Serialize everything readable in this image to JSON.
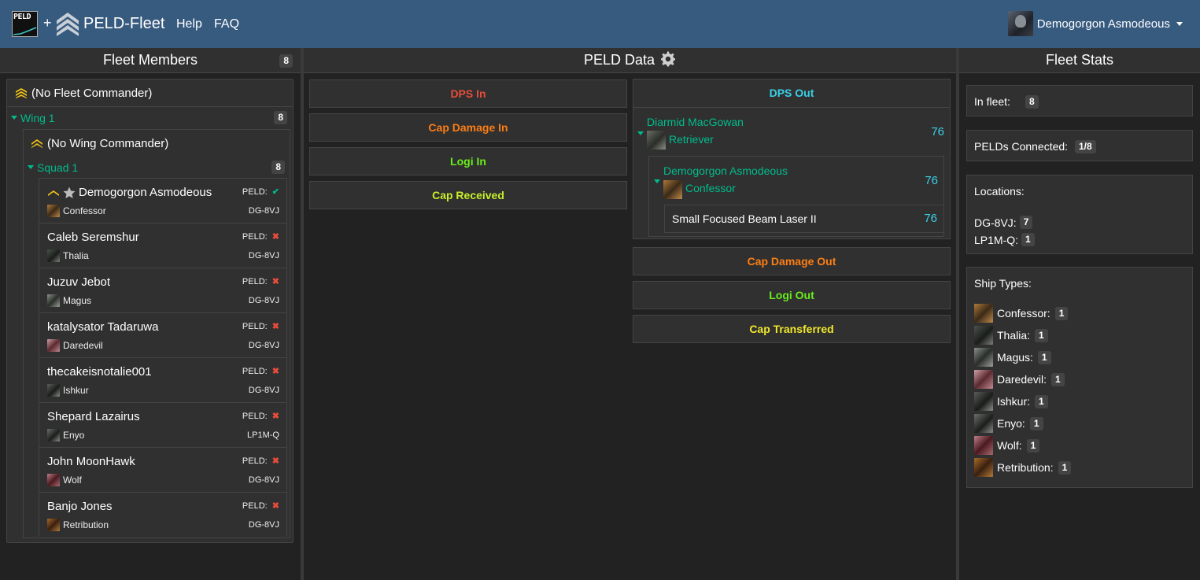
{
  "navbar": {
    "peld_logo_text": "PELD",
    "plus": "+",
    "brand": "PELD-Fleet",
    "help": "Help",
    "faq": "FAQ",
    "user_name": "Demogorgon Asmodeous"
  },
  "colors": {
    "navbar": "#375a7f",
    "background": "#222222",
    "panel": "#303030",
    "green": "#00bc8c",
    "red": "#e74c3c",
    "cyan": "#3bd0e8",
    "orange": "#fd7e14",
    "lime": "#6aed1c",
    "yellow": "#f0e82c",
    "gold": "#f5c518"
  },
  "fleet_members": {
    "title": "Fleet Members",
    "count": "8",
    "fleet_commander": "(No Fleet Commander)",
    "wing": {
      "label": "Wing 1",
      "count": "8",
      "commander": "(No Wing Commander)"
    },
    "squad": {
      "label": "Squad 1",
      "count": "8"
    },
    "peld_label": "PELD:",
    "members": [
      {
        "name": "Demogorgon Asmodeous",
        "ship": "Confessor",
        "location": "DG-8VJ",
        "peld": "✔",
        "icon": "confessor-icon"
      },
      {
        "name": "Caleb Seremshur",
        "ship": "Thalia",
        "location": "DG-8VJ",
        "peld": "✖",
        "icon": "thalia-icon"
      },
      {
        "name": "Juzuv Jebot",
        "ship": "Magus",
        "location": "DG-8VJ",
        "peld": "✖",
        "icon": "magus-icon"
      },
      {
        "name": "katalysator Tadaruwa",
        "ship": "Daredevil",
        "location": "DG-8VJ",
        "peld": "✖",
        "icon": "daredevil-icon"
      },
      {
        "name": "thecakeisnotalie001",
        "ship": "Ishkur",
        "location": "DG-8VJ",
        "peld": "✖",
        "icon": "ishkur-icon"
      },
      {
        "name": "Shepard Lazairus",
        "ship": "Enyo",
        "location": "LP1M-Q",
        "peld": "✖",
        "icon": "enyo-icon"
      },
      {
        "name": "John MoonHawk",
        "ship": "Wolf",
        "location": "DG-8VJ",
        "peld": "✖",
        "icon": "wolf-icon"
      },
      {
        "name": "Banjo Jones",
        "ship": "Retribution",
        "location": "DG-8VJ",
        "peld": "✖",
        "icon": "retribution-icon"
      }
    ]
  },
  "peld_data": {
    "title": "PELD Data",
    "dps_in": "DPS In",
    "cap_damage_in": "Cap Damage In",
    "logi_in": "Logi In",
    "cap_received": "Cap Received",
    "dps_out": {
      "label": "DPS Out",
      "source_name": "Diarmid MacGowan",
      "source_ship": "Retriever",
      "source_value": "76",
      "target_name": "Demogorgon Asmodeous",
      "target_ship": "Confessor",
      "target_value": "76",
      "weapon": "Small Focused Beam Laser II",
      "weapon_value": "76"
    },
    "cap_damage_out": "Cap Damage Out",
    "logi_out": "Logi Out",
    "cap_transferred": "Cap Transferred"
  },
  "fleet_stats": {
    "title": "Fleet Stats",
    "in_fleet_label": "In fleet:",
    "in_fleet": "8",
    "pelds_label": "PELDs Connected:",
    "pelds": "1/8",
    "locations_label": "Locations:",
    "locations": [
      {
        "name": "DG-8VJ:",
        "count": "7"
      },
      {
        "name": "LP1M-Q:",
        "count": "1"
      }
    ],
    "ship_types_label": "Ship Types:",
    "ship_types": [
      {
        "name": "Confessor:",
        "count": "1"
      },
      {
        "name": "Thalia:",
        "count": "1"
      },
      {
        "name": "Magus:",
        "count": "1"
      },
      {
        "name": "Daredevil:",
        "count": "1"
      },
      {
        "name": "Ishkur:",
        "count": "1"
      },
      {
        "name": "Enyo:",
        "count": "1"
      },
      {
        "name": "Wolf:",
        "count": "1"
      },
      {
        "name": "Retribution:",
        "count": "1"
      }
    ]
  }
}
